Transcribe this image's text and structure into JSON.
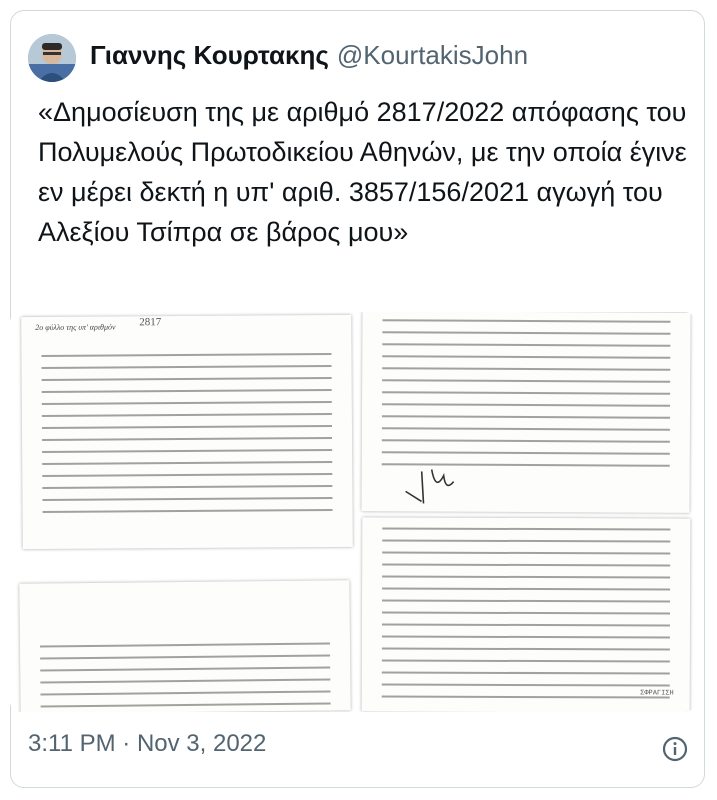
{
  "tweet": {
    "author_name": "Γιαννης Κουρτακης",
    "handle": "@KourtakisJohn",
    "text": "«Δημοσίευση της με αριθμό 2817/2022 απόφασης του Πολυμελούς Πρωτοδικείου Αθηνών, με την οποία έγινε εν μέρει δεκτή η υπ' αριθ. 3857/156/2021 αγωγή του Αλεξίου Τσίπρα σε βάρος μου»",
    "time": "3:11 PM",
    "separator": "·",
    "date": "Nov 3, 2022"
  },
  "media": {
    "doc_header": "2ο φύλλο της υπ' αριθμόν",
    "doc_number": "2817",
    "stamp_text": "ΣΦΡΑΓΙΣΗ"
  },
  "icons": {
    "info": "info-icon",
    "avatar": "avatar"
  },
  "colors": {
    "text_primary": "#0f1419",
    "text_secondary": "#536471",
    "border": "#cfd9de"
  }
}
